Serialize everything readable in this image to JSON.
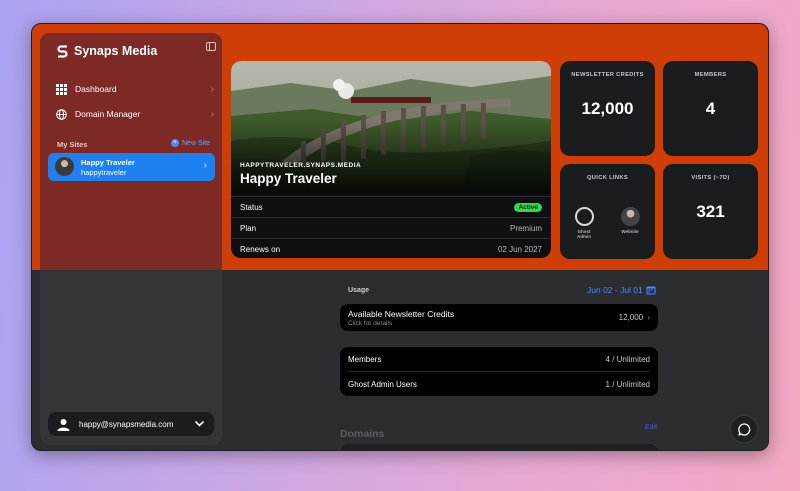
{
  "brand": {
    "name": "Synaps Media"
  },
  "sidebar": {
    "nav": [
      {
        "label": "Dashboard",
        "icon": "grid-icon"
      },
      {
        "label": "Domain Manager",
        "icon": "globe-icon"
      }
    ],
    "my_sites_label": "My Sites",
    "new_site_label": "New Site",
    "sites": [
      {
        "name": "Happy Traveler",
        "handle": "happytraveler"
      }
    ],
    "user_email": "happy@synapsmedia.com"
  },
  "hero": {
    "site_url": "HAPPYTRAVELER.SYNAPS.MEDIA",
    "title": "Happy Traveler",
    "rows": [
      {
        "label": "Status",
        "value": "Active"
      },
      {
        "label": "Plan",
        "value": "Premium"
      },
      {
        "label": "Renews on",
        "value": "02 Jun 2027"
      }
    ]
  },
  "cards": {
    "newsletter_credits": {
      "label": "NEWSLETTER CREDITS",
      "value": "12,000"
    },
    "members": {
      "label": "MEMBERS",
      "value": "4"
    },
    "quick_links": {
      "label": "QUICK LINKS",
      "items": [
        "Ghost Admin",
        "Website"
      ]
    },
    "visits": {
      "label": "VISITS (~7D)",
      "value": "321"
    }
  },
  "usage": {
    "label": "Usage",
    "date_range": "Jun 02 - Jul 01",
    "credits": {
      "title": "Available Newsletter Credits",
      "subtitle": "Click for details",
      "value": "12,000"
    },
    "rows": [
      {
        "label": "Members",
        "value": "4 / Unlimited"
      },
      {
        "label": "Ghost Admin Users",
        "value": "1 / Unlimited"
      }
    ]
  },
  "domains": {
    "label": "Domains",
    "edit_label": "Edit"
  },
  "colors": {
    "accent": "#cf3e06",
    "sidebar": "#7d2925",
    "selected": "#1f80f0",
    "link": "#4b8ef5",
    "active_badge": "#32d74b"
  }
}
